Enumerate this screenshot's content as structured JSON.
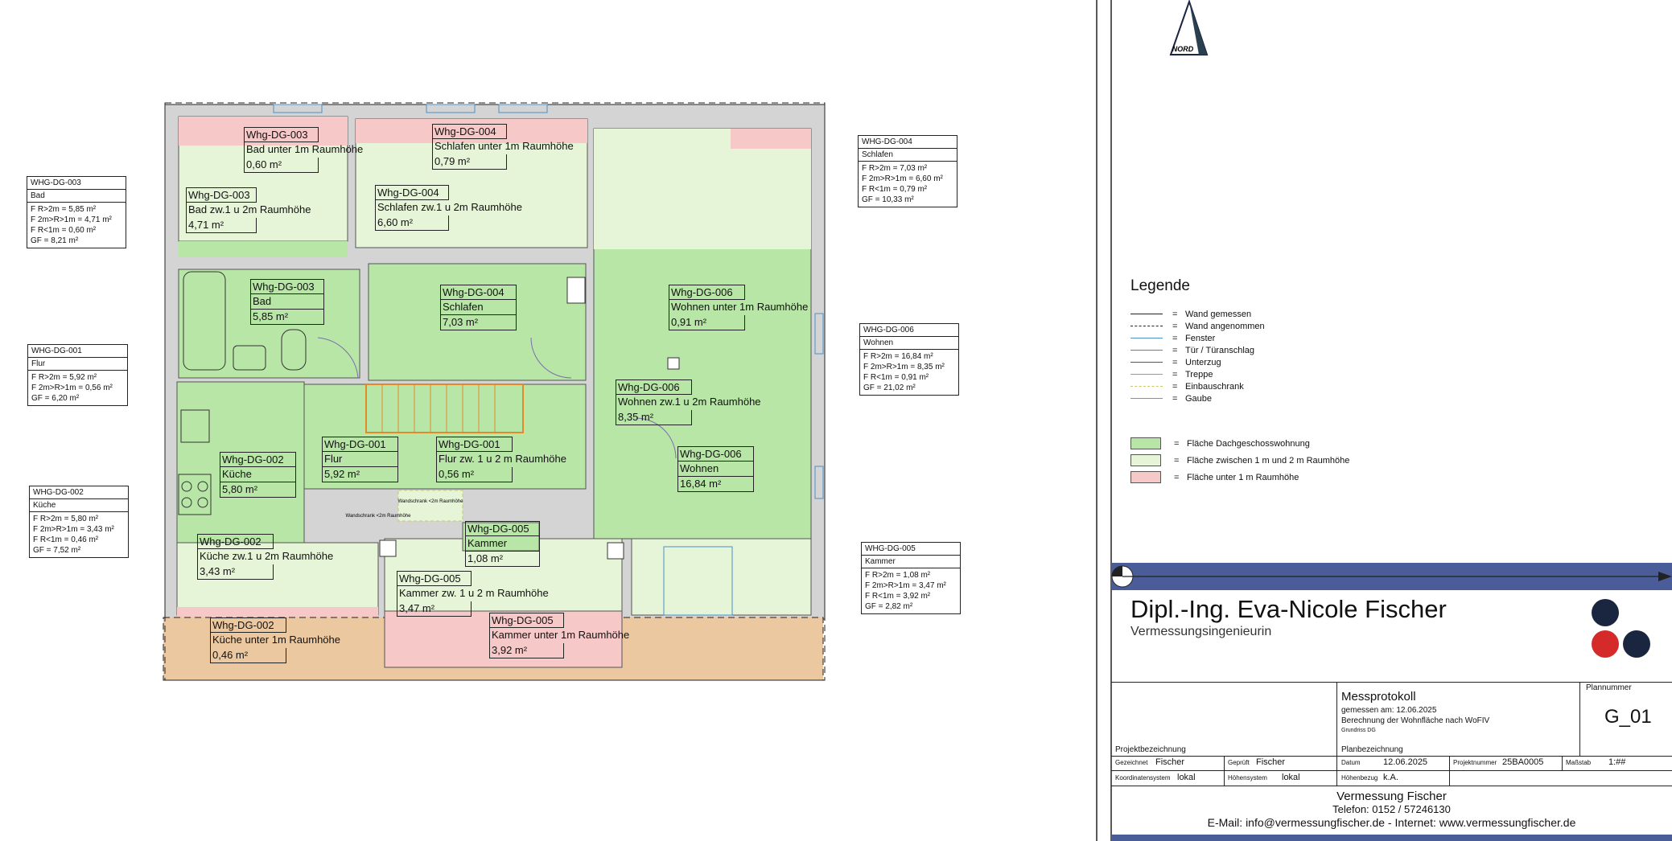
{
  "north": {
    "label": "NORD"
  },
  "rooms": [
    {
      "id": "Whg-DG-003",
      "name": "Bad unter 1m Raumhöhe",
      "area": "0,60 m²"
    },
    {
      "id": "Whg-DG-003",
      "name": "Bad zw.1 u 2m Raumhöhe",
      "area": "4,71 m²"
    },
    {
      "id": "Whg-DG-003",
      "name": "Bad",
      "area": "5,85 m²"
    },
    {
      "id": "Whg-DG-004",
      "name": "Schlafen unter 1m Raumhöhe",
      "area": "0,79 m²"
    },
    {
      "id": "Whg-DG-004",
      "name": "Schlafen zw.1 u 2m Raumhöhe",
      "area": "6,60 m²"
    },
    {
      "id": "Whg-DG-004",
      "name": "Schlafen",
      "area": "7,03 m²"
    },
    {
      "id": "Whg-DG-006",
      "name": "Wohnen unter 1m Raumhöhe",
      "area": "0,91 m²"
    },
    {
      "id": "Whg-DG-006",
      "name": "Wohnen zw.1 u 2m Raumhöhe",
      "area": "8,35 m²"
    },
    {
      "id": "Whg-DG-006",
      "name": "Wohnen",
      "area": "16,84 m²"
    },
    {
      "id": "Whg-DG-001",
      "name": "Flur",
      "area": "5,92 m²"
    },
    {
      "id": "Whg-DG-001",
      "name": "Flur zw. 1 u 2 m Raumhöhe",
      "area": "0,56 m²"
    },
    {
      "id": "Whg-DG-002",
      "name": "Küche",
      "area": "5,80 m²"
    },
    {
      "id": "Whg-DG-002",
      "name": "Küche zw.1 u 2m Raumhöhe",
      "area": "3,43 m²"
    },
    {
      "id": "Whg-DG-002",
      "name": "Küche unter 1m Raumhöhe",
      "area": "0,46 m²"
    },
    {
      "id": "Whg-DG-005",
      "name": "Kammer",
      "area": "1,08 m²"
    },
    {
      "id": "Whg-DG-005",
      "name": "Kammer zw. 1 u 2 m Raumhöhe",
      "area": "3,47 m²"
    },
    {
      "id": "Whg-DG-005",
      "name": "Kammer unter 1m Raumhöhe",
      "area": "3,92 m²"
    }
  ],
  "plan_notes": {
    "wandschrank_1": "Wandschrank <2m Raumhöhe",
    "wandschrank_2": "Wandschrank <2m Raumhöhe"
  },
  "summaries": [
    {
      "id": "WHG-DG-003",
      "name": "Bad",
      "lines": [
        "F R>2m = 5,85 m²",
        "F 2m>R>1m = 4,71 m²",
        "F R<1m = 0,60 m²",
        "GF = 8,21 m²"
      ]
    },
    {
      "id": "WHG-DG-001",
      "name": "Flur",
      "lines": [
        "F R>2m = 5,92 m²",
        "F 2m>R>1m = 0,56 m²",
        "GF = 6,20 m²"
      ]
    },
    {
      "id": "WHG-DG-002",
      "name": "Küche",
      "lines": [
        "F R>2m = 5,80 m²",
        "F 2m>R>1m = 3,43 m²",
        "F R<1m = 0,46 m²",
        "GF = 7,52 m²"
      ]
    },
    {
      "id": "WHG-DG-004",
      "name": "Schlafen",
      "lines": [
        "F R>2m = 7,03 m²",
        "F 2m>R>1m = 6,60 m²",
        "F R<1m = 0,79 m²",
        "GF = 10,33 m²"
      ]
    },
    {
      "id": "WHG-DG-006",
      "name": "Wohnen",
      "lines": [
        "F R>2m = 16,84 m²",
        "F 2m>R>1m = 8,35 m²",
        "F R<1m = 0,91 m²",
        "GF = 21,02 m²"
      ]
    },
    {
      "id": "WHG-DG-005",
      "name": "Kammer",
      "lines": [
        "F R>2m = 1,08 m²",
        "F 2m>R>1m = 3,47 m²",
        "F R<1m = 3,92 m²",
        "GF = 2,82 m²"
      ]
    }
  ],
  "legend": {
    "title": "Legende",
    "lines": [
      {
        "label": "Wand gemessen",
        "color": "#222222",
        "style": "solid"
      },
      {
        "label": "Wand angenommen",
        "color": "#222222",
        "style": "dashed"
      },
      {
        "label": "Fenster",
        "color": "#4a90c8",
        "style": "solid"
      },
      {
        "label": "Tür / Türanschlag",
        "color": "#7a6fb0",
        "style": "solid"
      },
      {
        "label": "Unterzug",
        "color": "#555555",
        "style": "solid"
      },
      {
        "label": "Treppe",
        "color": "#e08a2a",
        "style": "solid"
      },
      {
        "label": "Einbauschrank",
        "color": "#c8c86a",
        "style": "dashed"
      },
      {
        "label": "Gaube",
        "color": "#8aa040",
        "style": "solid"
      }
    ],
    "areas": [
      {
        "label": "Fläche Dachgeschosswohnung",
        "color": "#b8e6a6"
      },
      {
        "label": "Fläche zwischen 1 m und 2 m Raumhöhe",
        "color": "#e6f5d8"
      },
      {
        "label": "Fläche unter 1 m Raumhöhe",
        "color": "#f6c8c8"
      }
    ],
    "equals": "="
  },
  "title_block": {
    "name": "Dipl.-Ing. Eva-Nicole Fischer",
    "profession": "Vermessungsingenieurin",
    "plannummer_label": "Plannummer",
    "plannummer": "G_01",
    "document_title": "Messprotokoll",
    "measured": "gemessen am: 12.06.2025",
    "calc": "Berechnung der Wohnfläche nach WoFIV",
    "plan_detail": "Grundriss DG",
    "projektbezeichnung": "Projektbezeichnung",
    "planbezeichnung": "Planbezeichnung",
    "gezeichnet_label": "Gezeichnet",
    "gezeichnet": "Fischer",
    "geprueft_label": "Geprüft",
    "geprueft": "Fischer",
    "datum_label": "Datum",
    "datum": "12.06.2025",
    "projektnummer_label": "Projektnummer",
    "projektnummer": "25BA0005",
    "massstab_label": "Maßstab",
    "massstab": "1:##",
    "koord_label": "Koordinatensystem",
    "koord": "lokal",
    "hoehensys_label": "Höhensystem",
    "hoehensys": "lokal",
    "hoehenbezug_label": "Höhenbezug",
    "hoehenbezug": "k.A.",
    "company": "Vermessung Fischer",
    "phone": "Telefon: 0152 / 57246130",
    "contact": "E-Mail: info@vermessungfischer.de   -   Internet: www.vermessungfischer.de",
    "brand_colors": {
      "navy": "#1a2540",
      "red": "#d42a2a",
      "band": "#4a5d99"
    }
  }
}
